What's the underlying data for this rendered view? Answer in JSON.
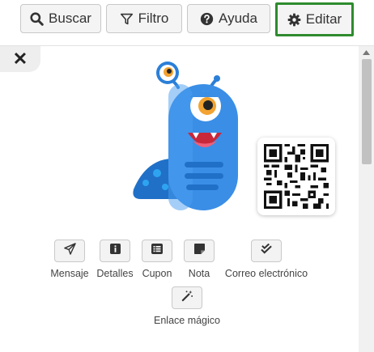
{
  "toolbar": {
    "search_label": "Buscar",
    "filter_label": "Filtro",
    "help_label": "Ayuda",
    "edit_label": "Editar",
    "edit_highlight_color": "#2e8b2e"
  },
  "panel": {
    "close_glyph": "✕",
    "mascot": {
      "icon": "blue-monster-mascot",
      "body_color": "#3a8ee6"
    },
    "qr": {
      "icon": "qr-code"
    },
    "actions": [
      {
        "label": "Mensaje",
        "icon": "paper-plane-icon"
      },
      {
        "label": "Detalles",
        "icon": "info-icon"
      },
      {
        "label": "Cupon",
        "icon": "list-icon"
      },
      {
        "label": "Nota",
        "icon": "sticky-note-icon"
      },
      {
        "label": "Correo electrónico",
        "icon": "check-double-icon"
      },
      {
        "label": "Enlace mágico",
        "icon": "magic-wand-icon"
      }
    ]
  }
}
